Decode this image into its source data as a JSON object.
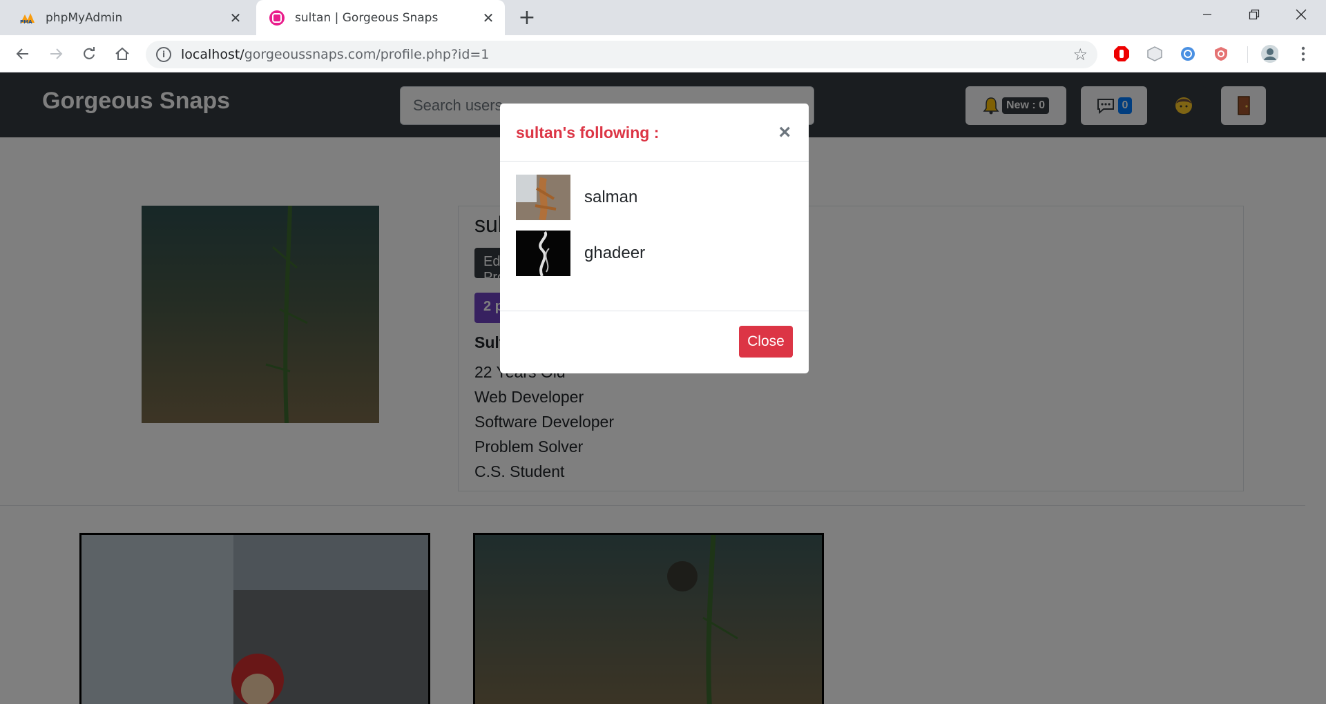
{
  "browser": {
    "tabs": [
      {
        "title": "phpMyAdmin",
        "favicon": "phpmyadmin-icon"
      },
      {
        "title": "sultan | Gorgeous Snaps",
        "favicon": "site-icon"
      }
    ],
    "url_host": "localhost/",
    "url_path": "gorgeoussnaps.com/profile.php?id=1"
  },
  "site": {
    "brand": "Gorgeous Snaps",
    "search_placeholder": "Search users",
    "notifications_label": "New : 0",
    "messages_count": "0"
  },
  "profile": {
    "name": "sultan",
    "edit_label": "Edit Profile",
    "posts_label": "2 posts",
    "full_name": "Sultan",
    "bio": [
      "22 Years Old",
      "Web Developer",
      "Software Developer",
      "Problem Solver",
      "C.S. Student"
    ]
  },
  "modal": {
    "title": "sultan's following :",
    "users": [
      "salman",
      "ghadeer"
    ],
    "close_label": "Close"
  },
  "colors": {
    "navbar": "#343a40",
    "danger": "#dc3545",
    "primary": "#007bff",
    "purple": "#6f42c1"
  }
}
